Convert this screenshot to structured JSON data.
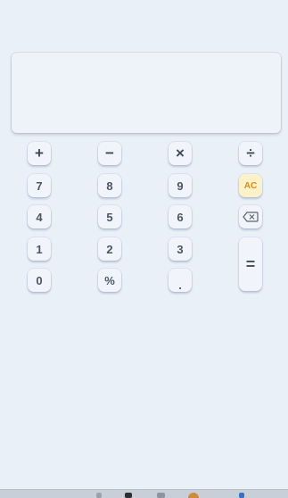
{
  "display": {
    "value": ""
  },
  "keys": {
    "plus": "+",
    "minus": "−",
    "multiply": "×",
    "divide": "÷",
    "seven": "7",
    "eight": "8",
    "nine": "9",
    "clear": "AC",
    "four": "4",
    "five": "5",
    "six": "6",
    "backspace_icon": "backspace-icon",
    "one": "1",
    "two": "2",
    "three": "3",
    "equals": "=",
    "zero": "0",
    "percent": "%",
    "decimal": "."
  },
  "colors": {
    "background": "#eaf0f8",
    "key": "#f1f5fb",
    "clear_key": "#fbf2c9",
    "clear_text": "#e08a1c"
  }
}
